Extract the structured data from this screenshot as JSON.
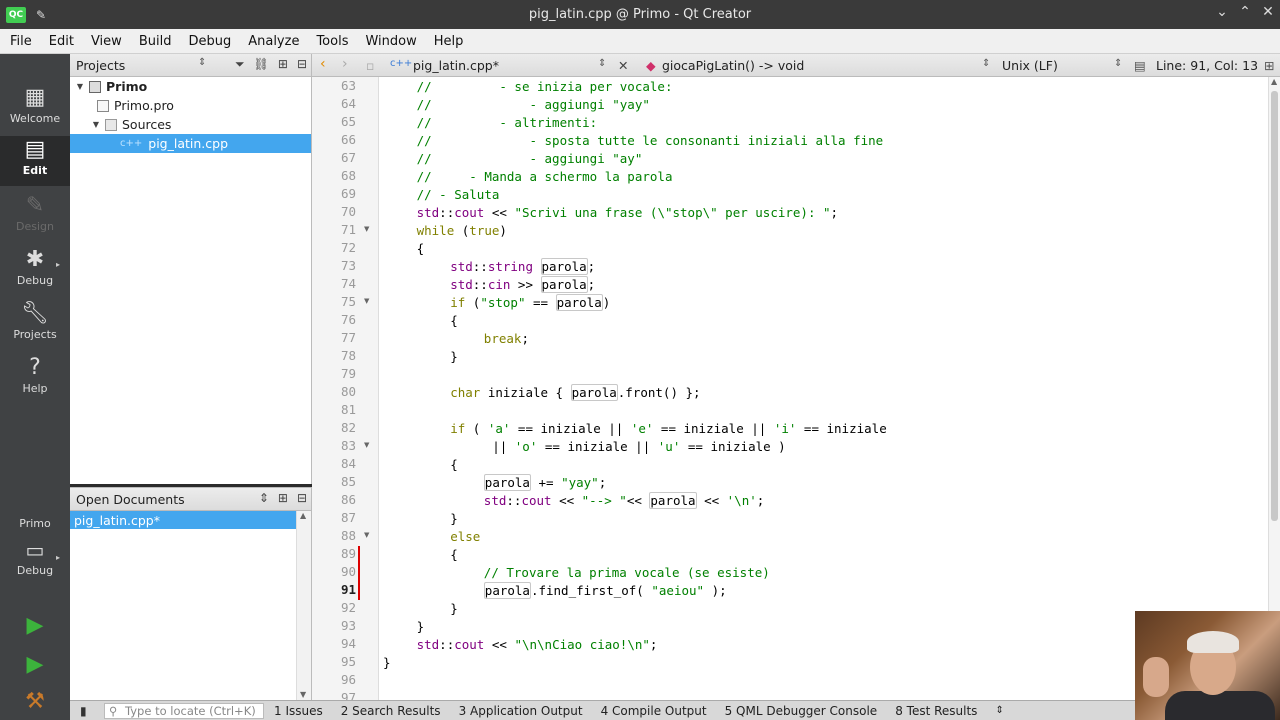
{
  "window": {
    "title": "pig_latin.cpp @ Primo - Qt Creator",
    "app_icon": "QC"
  },
  "menu": [
    "File",
    "Edit",
    "View",
    "Build",
    "Debug",
    "Analyze",
    "Tools",
    "Window",
    "Help"
  ],
  "modes": [
    {
      "label": "Welcome",
      "icon": "grid-icon"
    },
    {
      "label": "Edit",
      "icon": "document-icon"
    },
    {
      "label": "Design",
      "icon": "pen-icon"
    },
    {
      "label": "Debug",
      "icon": "bug-icon"
    },
    {
      "label": "Projects",
      "icon": "wrench-icon"
    },
    {
      "label": "Help",
      "icon": "question-icon"
    }
  ],
  "kit": {
    "project": "Primo",
    "config": "Debug"
  },
  "projects_pane": {
    "title": "Projects",
    "tree": [
      {
        "label": "Primo",
        "level": 0,
        "expanded": true
      },
      {
        "label": "Primo.pro",
        "level": 1
      },
      {
        "label": "Sources",
        "level": 1,
        "expanded": true
      },
      {
        "label": "pig_latin.cpp",
        "level": 2,
        "selected": true
      }
    ]
  },
  "open_docs": {
    "title": "Open Documents",
    "items": [
      "pig_latin.cpp*"
    ]
  },
  "editor": {
    "file": "pig_latin.cpp*",
    "function": "giocaPigLatin() -> void",
    "line_ending": "Unix (LF)",
    "position": "Line: 91, Col: 13"
  },
  "code_lines": [
    {
      "n": "63",
      "indent": 4,
      "html": "<span class='cm'>//         - se inizia per vocale:</span>"
    },
    {
      "n": "64",
      "indent": 4,
      "html": "<span class='cm'>//             - aggiungi \"yay\"</span>"
    },
    {
      "n": "65",
      "indent": 4,
      "html": "<span class='cm'>//         - altrimenti:</span>"
    },
    {
      "n": "66",
      "indent": 4,
      "html": "<span class='cm'>//             - sposta tutte le consonanti iniziali alla fine</span>"
    },
    {
      "n": "67",
      "indent": 4,
      "html": "<span class='cm'>//             - aggiungi \"ay\"</span>"
    },
    {
      "n": "68",
      "indent": 4,
      "html": "<span class='cm'>//     - Manda a schermo la parola</span>"
    },
    {
      "n": "69",
      "indent": 4,
      "html": "<span class='cm'>// - Saluta</span>"
    },
    {
      "n": "70",
      "indent": 4,
      "html": "<span class='ns'>std</span>::<span class='ns'>cout</span> &lt;&lt; <span class='st'>\"Scrivi una frase (\\\"stop\\\" per uscire): \"</span>;"
    },
    {
      "n": "71",
      "indent": 4,
      "fold": true,
      "html": "<span class='kw'>while</span> (<span class='kw'>true</span>)"
    },
    {
      "n": "72",
      "indent": 4,
      "html": "{"
    },
    {
      "n": "73",
      "indent": 8,
      "html": "<span class='ns'>std</span>::<span class='ty'>string</span> <span class='hv'>parola</span>;"
    },
    {
      "n": "74",
      "indent": 8,
      "html": "<span class='ns'>std</span>::<span class='ns'>cin</span> &gt;&gt; <span class='hv'>parola</span>;"
    },
    {
      "n": "75",
      "indent": 8,
      "fold": true,
      "html": "<span class='kw'>if</span> (<span class='st'>\"stop\"</span> == <span class='hv'>parola</span>)"
    },
    {
      "n": "76",
      "indent": 8,
      "html": "{"
    },
    {
      "n": "77",
      "indent": 12,
      "html": "<span class='kw'>break</span>;"
    },
    {
      "n": "78",
      "indent": 8,
      "html": "}"
    },
    {
      "n": "79",
      "indent": 0,
      "html": ""
    },
    {
      "n": "80",
      "indent": 8,
      "html": "<span class='kw'>char</span> iniziale { <span class='hv'>parola</span>.front() };"
    },
    {
      "n": "81",
      "indent": 0,
      "html": ""
    },
    {
      "n": "82",
      "indent": 8,
      "html": "<span class='kw'>if</span> ( <span class='st'>'a'</span> == iniziale || <span class='st'>'e'</span> == iniziale || <span class='st'>'i'</span> == iniziale"
    },
    {
      "n": "83",
      "indent": 13,
      "fold": true,
      "html": "|| <span class='st'>'o'</span> == iniziale || <span class='st'>'u'</span> == iniziale )"
    },
    {
      "n": "84",
      "indent": 8,
      "html": "{"
    },
    {
      "n": "85",
      "indent": 12,
      "html": "<span class='hv'>parola</span> += <span class='st'>\"yay\"</span>;"
    },
    {
      "n": "86",
      "indent": 12,
      "html": "<span class='ns'>std</span>::<span class='ns'>cout</span> &lt;&lt; <span class='st'>\"--&gt; \"</span>&lt;&lt; <span class='hv'>parola</span> &lt;&lt; <span class='st'>'\\n'</span>;"
    },
    {
      "n": "87",
      "indent": 8,
      "html": "}"
    },
    {
      "n": "88",
      "indent": 8,
      "fold": true,
      "html": "<span class='kw'>else</span>"
    },
    {
      "n": "89",
      "indent": 8,
      "changed": true,
      "html": "{"
    },
    {
      "n": "90",
      "indent": 12,
      "changed": true,
      "html": "<span class='cm'>// Trovare la prima vocale (se esiste)</span>"
    },
    {
      "n": "91",
      "indent": 12,
      "changed": true,
      "current": true,
      "html": "<span class='hv'>parola</span>.find_first_of( <span class='st'>\"aeiou\"</span> );"
    },
    {
      "n": "92",
      "indent": 8,
      "html": "}"
    },
    {
      "n": "93",
      "indent": 4,
      "html": "}"
    },
    {
      "n": "94",
      "indent": 4,
      "html": "<span class='ns'>std</span>::<span class='ns'>cout</span> &lt;&lt; <span class='st'>\"\\n\\nCiao ciao!\\n\"</span>;"
    },
    {
      "n": "95",
      "indent": 0,
      "html": "}"
    },
    {
      "n": "96",
      "indent": 0,
      "html": ""
    },
    {
      "n": "97",
      "indent": 0,
      "html": ""
    }
  ],
  "locator": {
    "placeholder": "Type to locate (Ctrl+K)"
  },
  "output_panes": [
    "1  Issues",
    "2  Search Results",
    "3  Application Output",
    "4  Compile Output",
    "5  QML Debugger Console",
    "8  Test Results"
  ],
  "icons": {
    "run": "run-icon",
    "debug_run": "debug-run-icon",
    "build": "hammer-icon"
  }
}
